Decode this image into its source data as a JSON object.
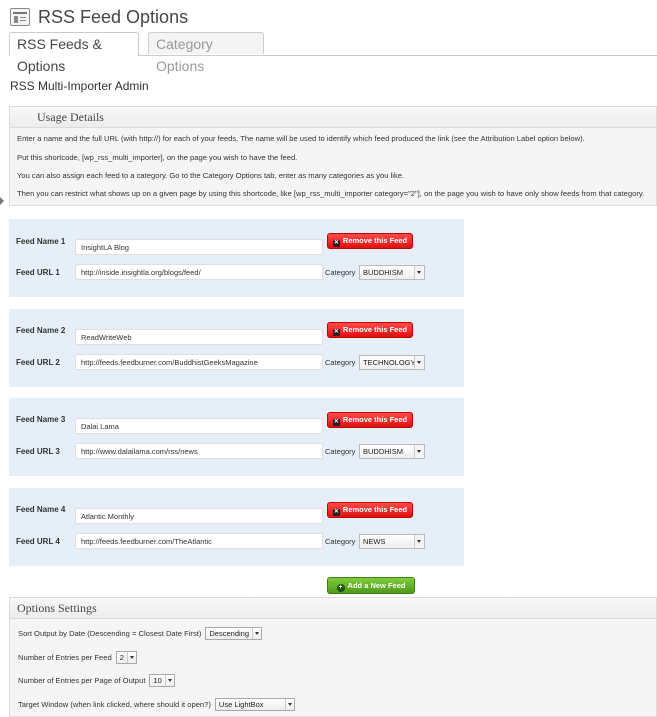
{
  "header": {
    "title": "RSS Feed Options",
    "icon": "settings-page-icon"
  },
  "tabs": [
    {
      "label": "RSS Feeds & Options",
      "active": true
    },
    {
      "label": "Category Options",
      "active": false
    }
  ],
  "section_title": "RSS Multi-Importer Admin",
  "usage": {
    "title": "Usage Details",
    "lines": [
      "Enter a name and the full URL (with http://) for each of your feeds. The name will be used to identify which feed produced the link (see the Attribution Label option below).",
      "Put this shortcode, [wp_rss_multi_importer], on the page you wish to have the feed.",
      "You can also assign each feed to a category. Go to the Category Options tab, enter as many categories as you like.",
      "Then you can restrict what shows up on a given page by using this shortcode, like [wp_rss_multi_importer category=\"2\"], on the page you wish to have only show feeds from that category."
    ]
  },
  "feeds": [
    {
      "name_label": "Feed Name 1",
      "url_label": "Feed URL 1",
      "name": "InsightLA Blog",
      "url": "http://inside.insightla.org/blogs/feed/",
      "category_label": "Category",
      "category": "BUDDHISM",
      "remove_label": "Remove this Feed"
    },
    {
      "name_label": "Feed Name 2",
      "url_label": "Feed URL 2",
      "name": "ReadWriteWeb",
      "url": "http://feeds.feedburner.com/BuddhistGeeksMagazine",
      "category_label": "Category",
      "category": "TECHNOLOGY",
      "remove_label": "Remove this Feed"
    },
    {
      "name_label": "Feed Name 3",
      "url_label": "Feed URL 3",
      "name": "Dalai Lama",
      "url": "http://www.dalailama.com/rss/news",
      "category_label": "Category",
      "category": "BUDDHISM",
      "remove_label": "Remove this Feed"
    },
    {
      "name_label": "Feed Name 4",
      "url_label": "Feed URL 4",
      "name": "Atlantic Monthly",
      "url": "http://feeds.feedburner.com/TheAtlantic",
      "category_label": "Category",
      "category": "NEWS",
      "remove_label": "Remove this Feed"
    }
  ],
  "add_feed_label": "Add a New Feed",
  "options": {
    "title": "Options Settings",
    "sort_label": "Sort Output by Date (Descending = Closest Date First)",
    "sort_value": "Descending",
    "entries_per_feed_label": "Number of Entries per Feed",
    "entries_per_feed_value": "2",
    "entries_per_page_label": "Number of Entries per Page of Output",
    "entries_per_page_value": "10",
    "target_window_label": "Target Window (when link clicked, where should it open?)",
    "target_window_value": "Use LightBox"
  },
  "colors": {
    "feed_panel_bg": "#e6eff8",
    "remove_button": "#e11a1a",
    "add_button": "#5aa61e"
  }
}
